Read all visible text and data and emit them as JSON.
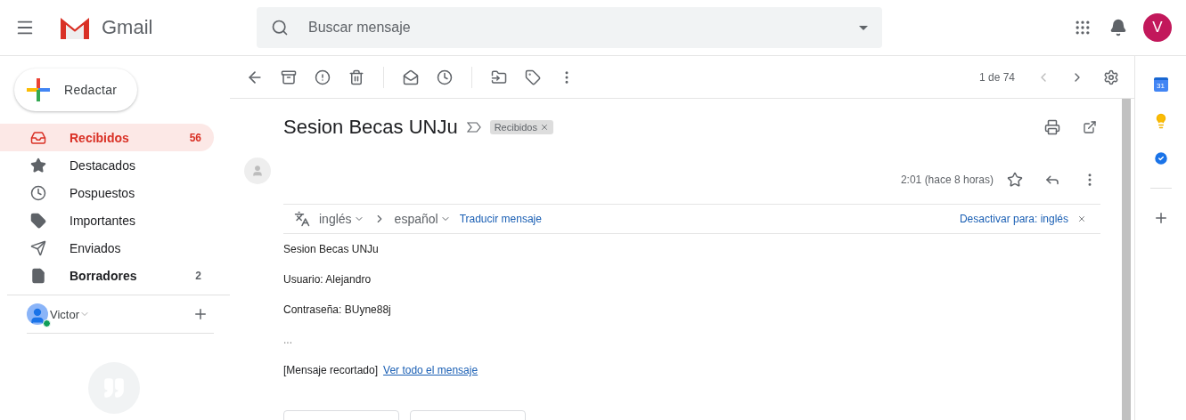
{
  "header": {
    "app_name": "Gmail",
    "search": {
      "placeholder": "Buscar mensaje"
    },
    "avatar_letter": "V"
  },
  "compose": {
    "label": "Redactar"
  },
  "sidebar": {
    "items": [
      {
        "kind": "inbox",
        "label": "Recibidos",
        "count": "56",
        "selected": true,
        "unread": true
      },
      {
        "kind": "star",
        "label": "Destacados",
        "selected": false,
        "unread": false
      },
      {
        "kind": "clock",
        "label": "Pospuestos",
        "selected": false,
        "unread": false
      },
      {
        "kind": "important",
        "label": "Importantes",
        "selected": false,
        "unread": false
      },
      {
        "kind": "send",
        "label": "Enviados",
        "selected": false,
        "unread": false
      },
      {
        "kind": "draft",
        "label": "Borradores",
        "count": "2",
        "selected": false,
        "unread": true
      }
    ],
    "account": {
      "name": "Victor",
      "online": true
    }
  },
  "toolbar": {
    "pager": "1 de 74"
  },
  "message": {
    "subject": "Sesion Becas UNJu",
    "label_chip": "Recibidos",
    "time": "2:01 (hace 8 horas)",
    "translate": {
      "from": "inglés",
      "to": "español",
      "action": "Traducir mensaje",
      "disable": "Desactivar para: inglés"
    },
    "body": [
      "Sesion Becas UNJu",
      "Usuario: Alejandro",
      "Contraseña: BUyne88j",
      "..."
    ],
    "clipped_note": "[Mensaje recortado]",
    "clipped_link": "Ver todo el mensaje"
  },
  "side_panel": {
    "calendar_day": "31"
  }
}
